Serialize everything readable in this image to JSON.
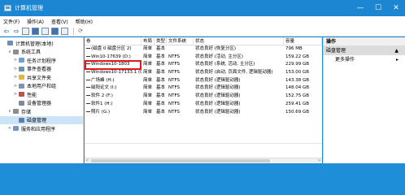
{
  "window": {
    "title": "计算机管理",
    "minimize": "—",
    "maximize": "☐",
    "close": "✕"
  },
  "menu": [
    "文件(F)",
    "操作(A)",
    "查看(V)",
    "帮助(H)"
  ],
  "tree": [
    {
      "label": "计算机管理(本地)",
      "indent": 0,
      "exp": "",
      "color": "#6c8fb8"
    },
    {
      "label": "系统工具",
      "indent": 1,
      "exp": "∨",
      "color": "#8c8c8c"
    },
    {
      "label": "任务计划程序",
      "indent": 2,
      "exp": ">",
      "color": "#6aa0d8"
    },
    {
      "label": "事件查看器",
      "indent": 2,
      "exp": ">",
      "color": "#6d8fb0"
    },
    {
      "label": "共享文件夹",
      "indent": 2,
      "exp": ">",
      "color": "#e2b93b"
    },
    {
      "label": "本地用户和组",
      "indent": 2,
      "exp": ">",
      "color": "#7b93b8"
    },
    {
      "label": "性能",
      "indent": 2,
      "exp": ">",
      "color": "#c0504d"
    },
    {
      "label": "设备管理器",
      "indent": 2,
      "exp": "",
      "color": "#7a8aa0"
    },
    {
      "label": "存储",
      "indent": 1,
      "exp": "∨",
      "color": "#8c8c8c"
    },
    {
      "label": "磁盘管理",
      "indent": 2,
      "exp": "",
      "color": "#5b7fae",
      "selected": true
    },
    {
      "label": "服务和应用程序",
      "indent": 1,
      "exp": ">",
      "color": "#7b93b8"
    }
  ],
  "table": {
    "headers": [
      "卷",
      "布局",
      "类型",
      "文件系统",
      "状态",
      "容量"
    ],
    "rows": [
      [
        "(磁盘 0 磁盘分区 2)",
        "简单",
        "基本",
        "",
        "状态良好 (恢复分区)",
        "796 MB"
      ],
      [
        "Win10-17639 (D:)",
        "简单",
        "基本",
        "NTFS",
        "状态良好 (活动, 主分区)",
        "159.22 GB"
      ],
      [
        "Windows10-1803",
        "简单",
        "基本",
        "NTFS",
        "状态良好 (系统, 活动, 主分区)",
        "229.99 GB"
      ],
      [
        "Windows10-17133.1 (C:)",
        "简单",
        "基本",
        "NTFS",
        "状态良好 (启动, 页面文件, 逻辑驱动器)",
        "153.00 GB"
      ],
      [
        "广场峰 (H:)",
        "简单",
        "基本",
        "NTFS",
        "状态良好 (逻辑驱动器)",
        "143.38 GB"
      ],
      [
        "磁阳论文 (I:)",
        "简单",
        "基本",
        "NTFS",
        "状态良好 (逻辑驱动器)",
        "148.04 GB"
      ],
      [
        "软件 2 (F:)",
        "简单",
        "基本",
        "NTFS",
        "状态良好 (逻辑驱动器)",
        "152.75 GB"
      ],
      [
        "软件1 (H:)",
        "简单",
        "基本",
        "NTFS",
        "状态良好 (逻辑驱动器)",
        "259.41 GB"
      ],
      [
        "照片 (G:)",
        "简单",
        "基本",
        "NTFS",
        "状态良好 (逻辑驱动器)",
        "150.69 GB"
      ]
    ]
  },
  "actions": {
    "title": "操作",
    "section": "磁盘管理",
    "more": "更多操作"
  }
}
